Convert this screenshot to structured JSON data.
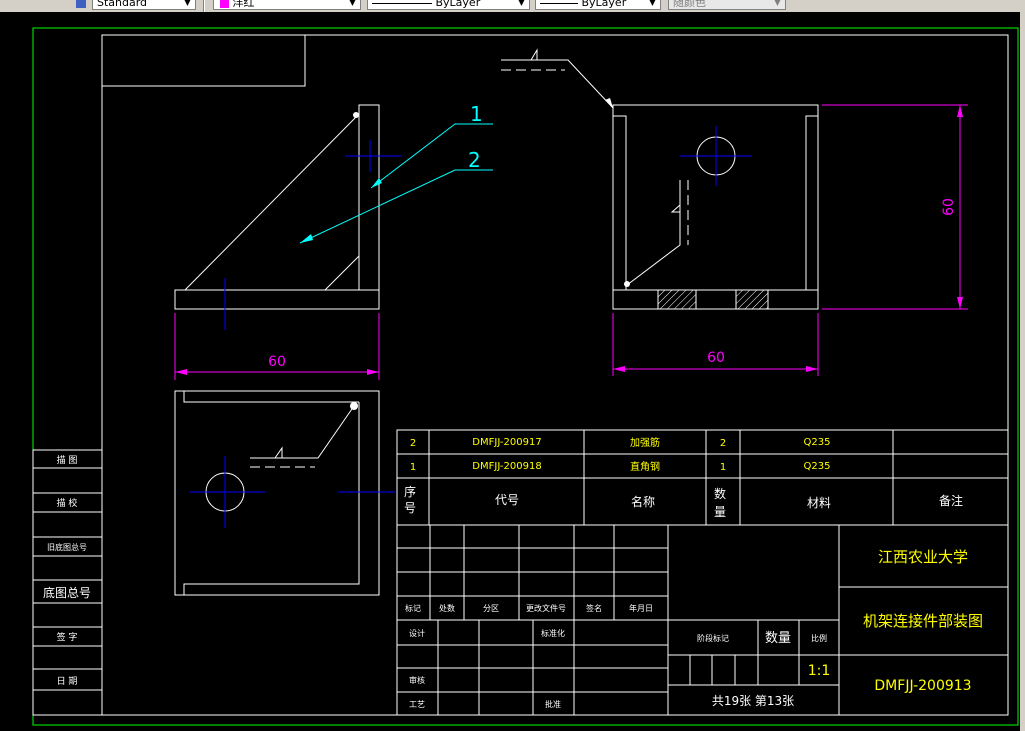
{
  "toolbar": {
    "textstyle_value": "Standard",
    "color_value": "洋红",
    "color_swatch": "#ff00ff",
    "linetype_value": "ByLayer",
    "lineweight_value": "ByLayer",
    "plotstyle_value": "随颜色"
  },
  "colors": {
    "frame": "#ffffff",
    "border": "#00ff00",
    "dimension": "#ff00ff",
    "leader": "#00ffff",
    "center": "#0000ff",
    "title_text": "#ffff00"
  },
  "drawing": {
    "dim_front_width": "60",
    "dim_side_width": "60",
    "dim_side_height": "60",
    "balloon_1": "1",
    "balloon_2": "2"
  },
  "bom": {
    "rows": [
      {
        "no": "2",
        "code": "DMFJJ-200917",
        "name": "加强筋",
        "qty": "2",
        "material": "Q235"
      },
      {
        "no": "1",
        "code": "DMFJJ-200918",
        "name": "直角钢",
        "qty": "1",
        "material": "Q235"
      }
    ],
    "header": {
      "no_a": "序",
      "no_b": "号",
      "code": "代号",
      "name": "名称",
      "qty_a": "数",
      "qty_b": "量",
      "material": "材料",
      "remark": "备注"
    }
  },
  "title_block": {
    "school": "江西农业大学",
    "drawing_title": "机架连接件部装图",
    "drawing_number": "DMFJJ-200913",
    "qty_label": "数量",
    "scale_label": "比例",
    "scale_value": "1:1",
    "stage_label": "阶段标记",
    "sheets": "共19张  第13张",
    "rev_headers": [
      "标记",
      "处数",
      "分区",
      "更改文件号",
      "签名",
      "年月日"
    ],
    "designer_label": "设计",
    "std_label": "标准化",
    "review_label": "审核",
    "process_label": "工艺",
    "approve_label": "批准"
  },
  "side_column": {
    "labels": [
      "描 图",
      "描 校",
      "旧底图总号",
      "底图总号",
      "签 字",
      "日 期"
    ]
  }
}
